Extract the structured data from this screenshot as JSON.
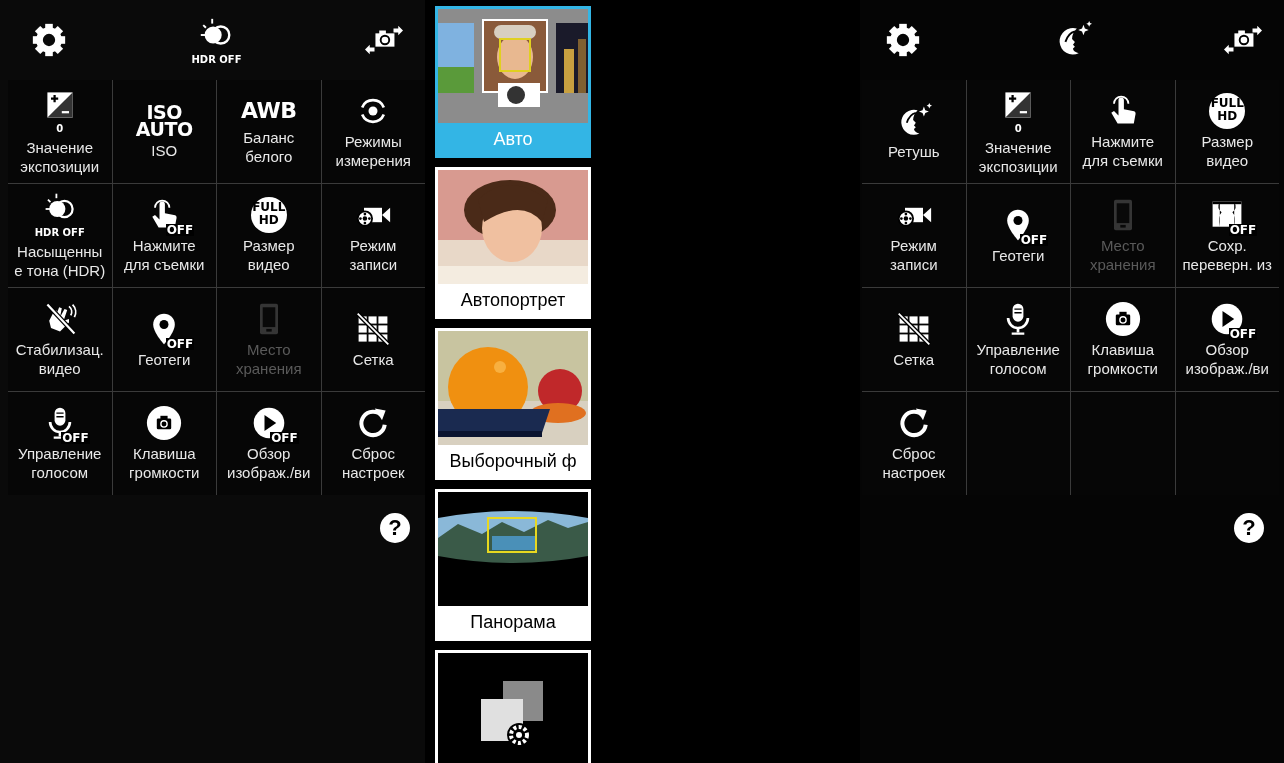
{
  "left_panel": {
    "top_bar": {
      "left": {
        "kind": "settings"
      },
      "center": {
        "kind": "hdr",
        "icon_text": "HDR OFF"
      },
      "right": {
        "kind": "switch-camera"
      }
    },
    "grid": [
      {
        "kind": "exposure",
        "icon_text": "0",
        "label": "Значение\nэкспозиции",
        "disabled": false
      },
      {
        "kind": "iso",
        "icon_text": "ISO\nAUTO",
        "label": "ISO",
        "disabled": false
      },
      {
        "kind": "awb",
        "icon_text": "AWB",
        "label": "Баланс\nбелого",
        "disabled": false
      },
      {
        "kind": "metering",
        "label": "Режимы\nизмерения",
        "disabled": false
      },
      {
        "kind": "hdr",
        "icon_text": "HDR OFF",
        "label": "Насыщенны\nе тона (HDR)",
        "disabled": false
      },
      {
        "kind": "touch",
        "badge": "OFF",
        "label": "Нажмите\nдля съемки",
        "disabled": false
      },
      {
        "kind": "fullhd",
        "icon_text": "FULL\nHD",
        "label": "Размер\nвидео",
        "disabled": false
      },
      {
        "kind": "recording",
        "label": "Режим\nзаписи",
        "disabled": false
      },
      {
        "kind": "stabilization",
        "label": "Стабилизац.\nвидео",
        "disabled": false
      },
      {
        "kind": "geotag",
        "badge": "OFF",
        "label": "Геотеги",
        "disabled": false
      },
      {
        "kind": "storage",
        "label": "Место\nхранения",
        "disabled": true
      },
      {
        "kind": "grid",
        "label": "Сетка",
        "disabled": false
      },
      {
        "kind": "voice",
        "badge": "OFF",
        "label": "Управление\nголосом",
        "disabled": false
      },
      {
        "kind": "volume-key",
        "label": "Клавиша\nгромкости",
        "disabled": false
      },
      {
        "kind": "review",
        "badge": "OFF",
        "label": "Обзор\nизображ./ви",
        "disabled": false
      },
      {
        "kind": "reset",
        "label": "Сброс\nнастроек",
        "disabled": false
      }
    ],
    "help": "?"
  },
  "modes": [
    {
      "kind": "picture",
      "label": "Авто",
      "selected": true
    },
    {
      "kind": "picture",
      "label": "Автопортрет",
      "selected": false
    },
    {
      "kind": "picture",
      "label": "Выборочный ф",
      "selected": false
    },
    {
      "kind": "picture",
      "label": "Панорама",
      "selected": false
    },
    {
      "kind": "icon",
      "selected": false
    }
  ],
  "right_panel": {
    "top_bar": {
      "left": {
        "kind": "settings"
      },
      "center": {
        "kind": "retouch"
      },
      "right": {
        "kind": "switch-camera"
      }
    },
    "grid": [
      {
        "kind": "retouch",
        "label": "Ретушь",
        "disabled": false
      },
      {
        "kind": "exposure",
        "icon_text": "0",
        "label": "Значение\nэкспозиции",
        "disabled": false
      },
      {
        "kind": "touch",
        "label": "Нажмите\nдля съемки",
        "disabled": false
      },
      {
        "kind": "fullhd",
        "icon_text": "FULL\nHD",
        "label": "Размер\nвидео",
        "disabled": false
      },
      {
        "kind": "recording",
        "label": "Режим\nзаписи",
        "disabled": false
      },
      {
        "kind": "geotag",
        "badge": "OFF",
        "label": "Геотеги",
        "disabled": false
      },
      {
        "kind": "storage",
        "label": "Место\nхранения",
        "disabled": true
      },
      {
        "kind": "flip-save",
        "badge": "OFF",
        "label": "Сохр.\nпереверн. из",
        "disabled": false
      },
      {
        "kind": "grid",
        "label": "Сетка",
        "disabled": false
      },
      {
        "kind": "voice",
        "label": "Управление\nголосом",
        "disabled": false
      },
      {
        "kind": "volume-key",
        "label": "Клавиша\nгромкости",
        "disabled": false
      },
      {
        "kind": "review",
        "badge": "OFF",
        "label": "Обзор\nизображ./ви",
        "disabled": false
      },
      {
        "kind": "reset",
        "label": "Сброс\nнастроек",
        "disabled": false
      }
    ],
    "help": "?"
  }
}
